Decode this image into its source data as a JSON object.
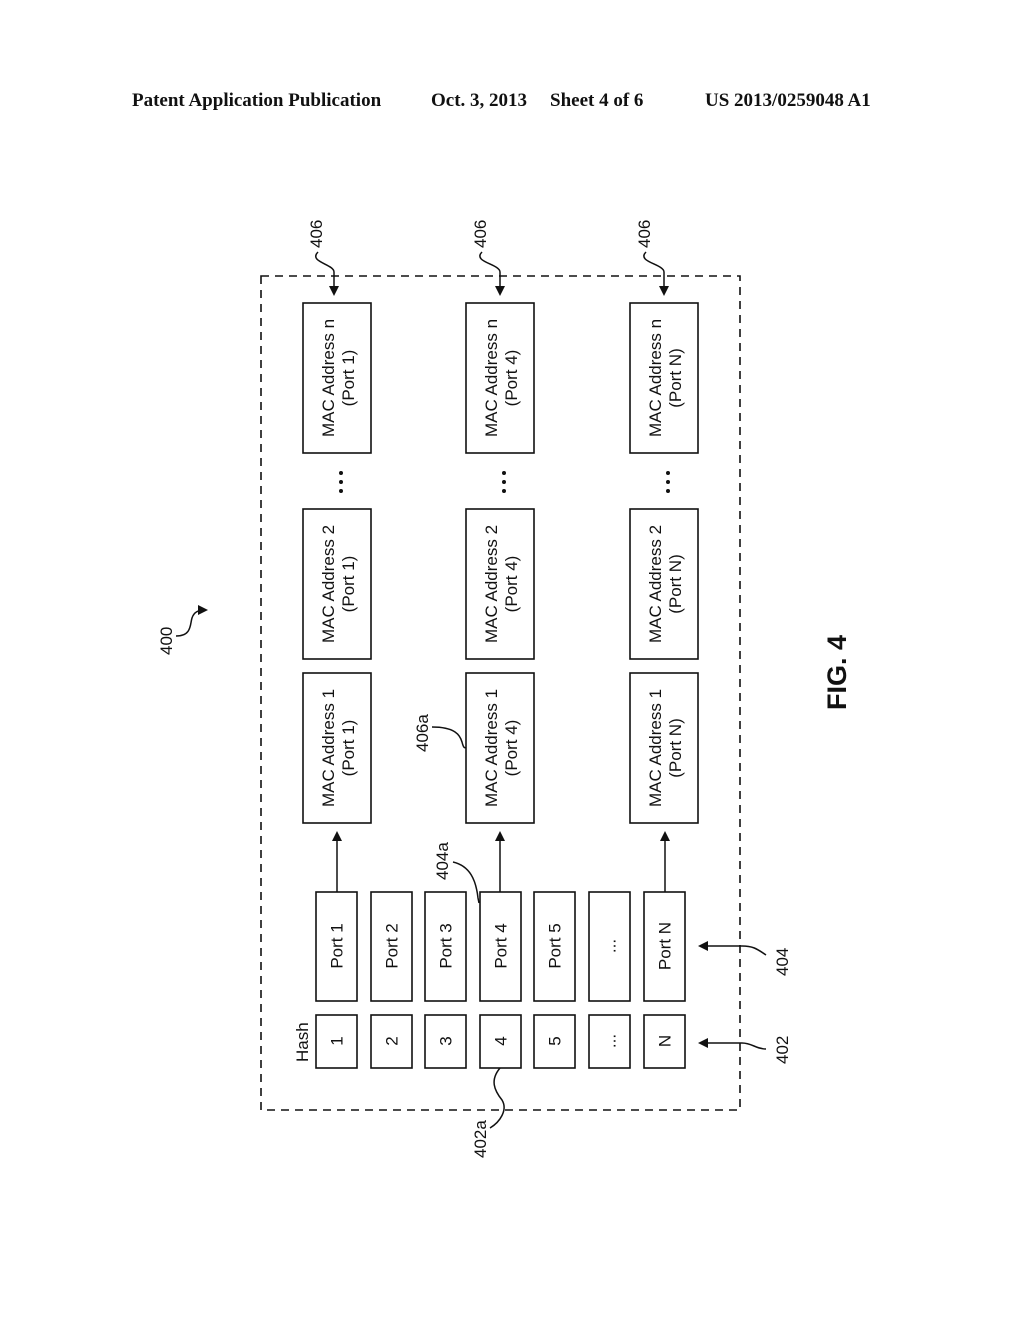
{
  "header": {
    "publication": "Patent Application Publication",
    "date": "Oct. 3, 2013",
    "sheet": "Sheet 4 of 6",
    "number": "US 2013/0259048 A1"
  },
  "figure": {
    "label": "FIG. 4",
    "ref_400": "400",
    "ref_402": "402",
    "ref_402a": "402a",
    "ref_404": "404",
    "ref_404a": "404a",
    "ref_406": "406",
    "ref_406a": "406a",
    "hash_title": "Hash",
    "hash_entries": [
      "1",
      "2",
      "3",
      "4",
      "5",
      "...",
      "N"
    ],
    "port_entries": [
      "Port 1",
      "Port 2",
      "Port 3",
      "Port 4",
      "Port 5",
      "...",
      "Port N"
    ],
    "mac_columns": [
      {
        "port": "(Port 1)",
        "entries": [
          "MAC Address 1",
          "MAC Address 2",
          "MAC Address n"
        ]
      },
      {
        "port": "(Port 4)",
        "entries": [
          "MAC Address 1",
          "MAC Address 2",
          "MAC Address n"
        ]
      },
      {
        "port": "(Port N)",
        "entries": [
          "MAC Address 1",
          "MAC Address 2",
          "MAC Address n"
        ]
      }
    ],
    "ellipsis": "..."
  }
}
